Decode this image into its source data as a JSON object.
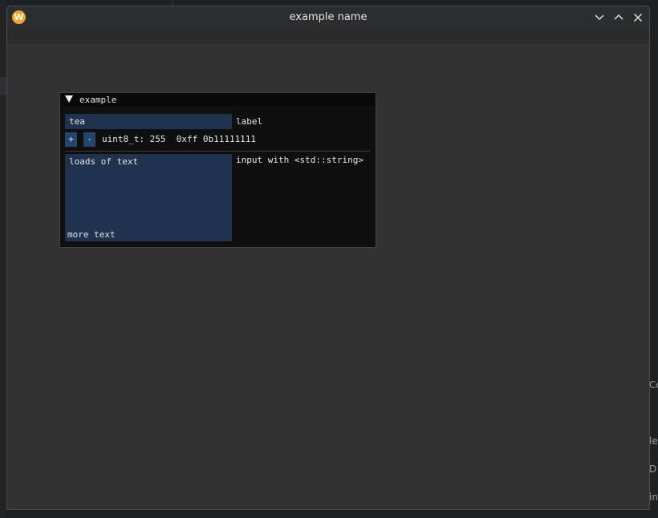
{
  "window": {
    "title": "example name",
    "app_icon_glyph": "W",
    "controls": [
      "minimize-icon",
      "maximize-icon",
      "close-icon"
    ]
  },
  "background": {
    "right_fragments": [
      "Co",
      "le",
      "D",
      "in"
    ]
  },
  "panel": {
    "title": "example",
    "text_input": {
      "value": "tea",
      "label": "label"
    },
    "stepper": {
      "plus": "+",
      "minus": "-",
      "readout": "uint8_t: 255  0xff 0b11111111"
    },
    "multiline": {
      "line1": "loads of text",
      "line2": "more text",
      "label": "input with <std::string>"
    }
  },
  "colors": {
    "window_bg": "#323232",
    "panel_bg": "#0f0f0f",
    "field_bg": "#1f324e",
    "button_bg": "#25456e",
    "app_icon": "#f0a52a"
  }
}
